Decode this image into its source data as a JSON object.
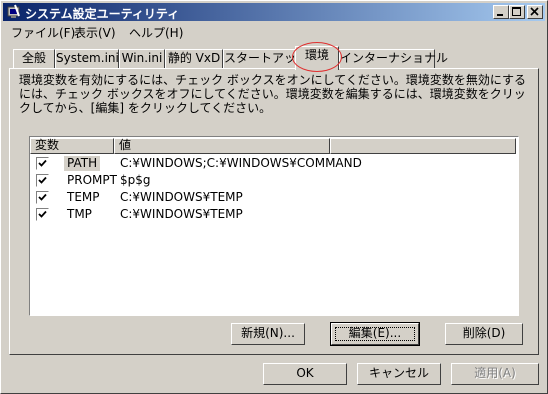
{
  "window": {
    "title": "システム設定ユーティリティ",
    "title_bar_color": "#0a246a"
  },
  "menu": [
    {
      "label": "ファイル(F)"
    },
    {
      "label": "表示(V)"
    },
    {
      "label": "ヘルプ(H)"
    }
  ],
  "tabs": [
    {
      "label": "全般"
    },
    {
      "label": "System.ini"
    },
    {
      "label": "Win.ini"
    },
    {
      "label": "静的 VxD"
    },
    {
      "label": "スタートアップ"
    },
    {
      "label": "環境",
      "active": true
    },
    {
      "label": "インターナショナル"
    }
  ],
  "description": "環境変数を有効にするには、チェック ボックスをオンにしてください。環境変数を無効にするには、チェック ボックスをオフにしてください。環境変数を編集するには、環境変数をクリックしてから、[編集] をクリックしてください。",
  "list": {
    "headers": [
      "変数",
      "値"
    ],
    "rows": [
      {
        "checked": true,
        "name": "PATH",
        "value": "C:¥WINDOWS;C:¥WINDOWS¥COMMAND",
        "selected": true
      },
      {
        "checked": true,
        "name": "PROMPT",
        "value": "$p$g"
      },
      {
        "checked": true,
        "name": "TEMP",
        "value": "C:¥WINDOWS¥TEMP"
      },
      {
        "checked": true,
        "name": "TMP",
        "value": "C:¥WINDOWS¥TEMP"
      }
    ]
  },
  "panel_buttons": {
    "new_label": "新規(N)...",
    "edit_label": "編集(E)...",
    "delete_label": "削除(D)"
  },
  "dialog_buttons": {
    "ok_label": "OK",
    "cancel_label": "キャンセル",
    "apply_label": "適用(A)"
  },
  "highlight_color": "#e03030"
}
